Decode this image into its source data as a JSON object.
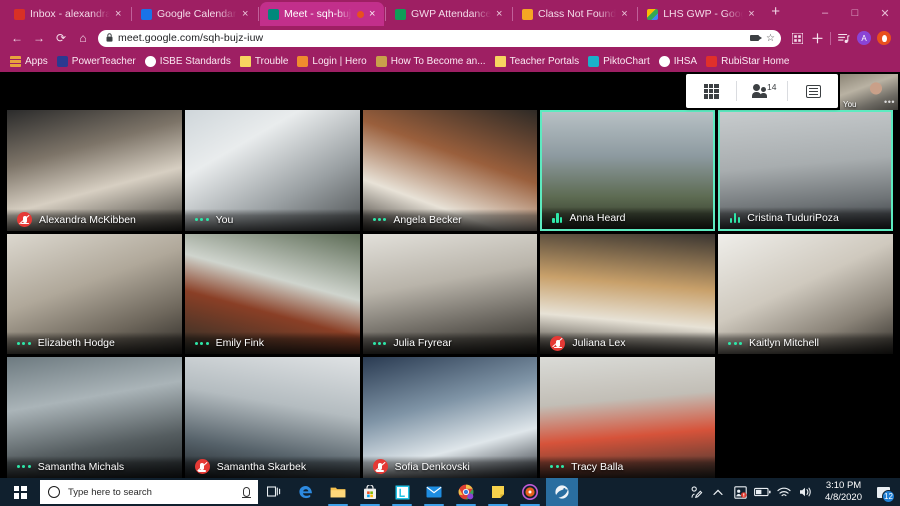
{
  "browser": {
    "tabs": [
      {
        "label": "Inbox - alexandra.vo",
        "favicon": "gmail-icon",
        "color": "#d93025",
        "active": false,
        "audio": false
      },
      {
        "label": "Google Calendar - A",
        "favicon": "calendar-icon",
        "color": "#1a73e8",
        "active": false,
        "audio": false
      },
      {
        "label": "Meet - sqh-bujz",
        "favicon": "meet-icon",
        "color": "#00897b",
        "active": true,
        "audio": true
      },
      {
        "label": "GWP Attendance - G",
        "favicon": "sheets-icon",
        "color": "#0f9d58",
        "active": false,
        "audio": false
      },
      {
        "label": "Class Not Found",
        "favicon": "contacts-icon",
        "color": "#f5a623",
        "active": false,
        "audio": false
      },
      {
        "label": "LHS GWP - Google D",
        "favicon": "drive-icon",
        "color": "#fbbc04",
        "active": false,
        "audio": false
      }
    ],
    "new_tab_label": "+",
    "close_label": "×",
    "window_buttons": {
      "minimize": "–",
      "maximize": "□",
      "close": "✕"
    },
    "nav": {
      "back": "←",
      "forward": "→",
      "reload": "⟳",
      "home": "⌂"
    },
    "omnibox": {
      "url": "meet.google.com/sqh-bujz-iuw",
      "lock": "🔒",
      "star": "☆",
      "camera_icon": "camera-blocked-icon"
    },
    "toolbar_icons": [
      "extensions-grid-icon",
      "add-icon",
      "reading-list-icon",
      "profile-avatar",
      "browser-profile-icon"
    ],
    "profile_letter": "A",
    "bookmarks": [
      {
        "label": "Apps",
        "icon": "apps-grid-icon",
        "color": "#e8a33d"
      },
      {
        "label": "PowerTeacher",
        "icon": "powerteacher-icon",
        "color": "#2b3990"
      },
      {
        "label": "ISBE Standards",
        "icon": "globe-icon",
        "color": "#ffffff"
      },
      {
        "label": "Trouble",
        "icon": "folder-icon",
        "color": "#f7d560"
      },
      {
        "label": "Login | Hero",
        "icon": "hero-icon",
        "color": "#f08c2e"
      },
      {
        "label": "How To Become an...",
        "icon": "bookmark-icon",
        "color": "#c9a14b"
      },
      {
        "label": "Teacher Portals",
        "icon": "folder-icon",
        "color": "#f7d560"
      },
      {
        "label": "PiktoChart",
        "icon": "piktochart-icon",
        "color": "#1bb1c9"
      },
      {
        "label": "IHSA",
        "icon": "globe-icon",
        "color": "#ffffff"
      },
      {
        "label": "RubiStar Home",
        "icon": "rubistar-icon",
        "color": "#e0302a"
      }
    ]
  },
  "meet": {
    "controls": {
      "layout_label": "grid-icon",
      "participants_icon": "people-icon",
      "participant_count": "14",
      "chat_icon": "chat-icon"
    },
    "self_view": {
      "label": "You",
      "more_label": "•••"
    },
    "accent_speaking": "#5debc0",
    "participants": [
      {
        "name": "Alexandra McKibben",
        "status": "muted",
        "speaking": false,
        "row": 0,
        "col": 0
      },
      {
        "name": "You",
        "status": "audio",
        "speaking": false,
        "row": 0,
        "col": 1
      },
      {
        "name": "Angela Becker",
        "status": "audio",
        "speaking": false,
        "row": 0,
        "col": 2
      },
      {
        "name": "Anna Heard",
        "status": "talking",
        "speaking": true,
        "row": 0,
        "col": 3
      },
      {
        "name": "Cristina TuduriPoza",
        "status": "talking",
        "speaking": true,
        "row": 0,
        "col": 4
      },
      {
        "name": "Elizabeth Hodge",
        "status": "audio",
        "speaking": false,
        "row": 1,
        "col": 0
      },
      {
        "name": "Emily Fink",
        "status": "audio",
        "speaking": false,
        "row": 1,
        "col": 1
      },
      {
        "name": "Julia Fryrear",
        "status": "audio",
        "speaking": false,
        "row": 1,
        "col": 2
      },
      {
        "name": "Juliana Lex",
        "status": "muted",
        "speaking": false,
        "row": 1,
        "col": 3
      },
      {
        "name": "Kaitlyn Mitchell",
        "status": "audio",
        "speaking": false,
        "row": 1,
        "col": 4
      },
      {
        "name": "Samantha Michals",
        "status": "audio",
        "speaking": false,
        "row": 2,
        "col": 0
      },
      {
        "name": "Samantha Skarbek",
        "status": "muted",
        "speaking": false,
        "row": 2,
        "col": 1
      },
      {
        "name": "Sofia Denkovski",
        "status": "muted",
        "speaking": false,
        "row": 2,
        "col": 2
      },
      {
        "name": "Tracy Balla",
        "status": "audio",
        "speaking": false,
        "row": 2,
        "col": 3
      }
    ]
  },
  "taskbar": {
    "start_label": "windows-start-icon",
    "search_placeholder": "Type here to search",
    "search_value": "",
    "icons": [
      {
        "name": "task-view-icon"
      },
      {
        "name": "edge-icon"
      },
      {
        "name": "file-explorer-icon"
      },
      {
        "name": "microsoft-store-icon"
      },
      {
        "name": "lausd-app-icon"
      },
      {
        "name": "mail-icon"
      },
      {
        "name": "chrome-icon"
      },
      {
        "name": "sticky-notes-icon"
      },
      {
        "name": "media-player-icon"
      },
      {
        "name": "photos-icon"
      }
    ],
    "tray": [
      "pen-tray-icon",
      "show-hidden-icons-chevron",
      "security-icon",
      "battery-icon",
      "wifi-icon",
      "volume-icon"
    ],
    "time": "3:10 PM",
    "date": "4/8/2020",
    "notification_count": "12"
  }
}
